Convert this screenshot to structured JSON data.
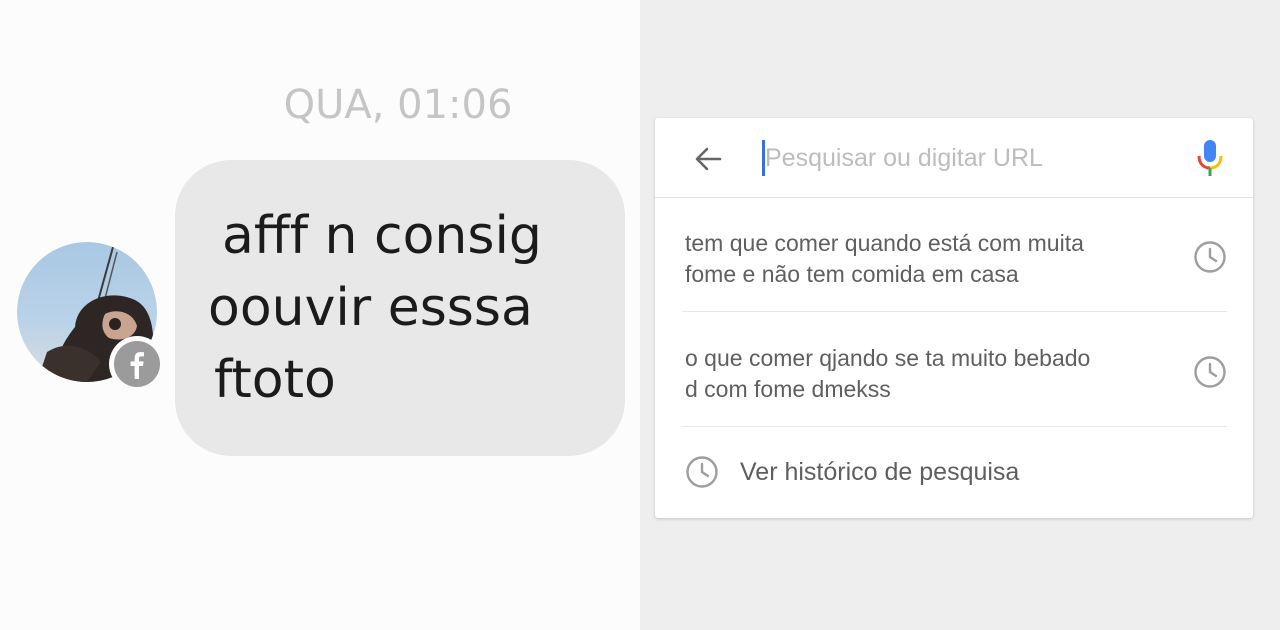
{
  "messenger": {
    "timestamp": "QUA, 01:06",
    "message_lines": [
      "afff n consig",
      "oouvir esssa",
      "ftoto"
    ],
    "badge_icon": "facebook-icon"
  },
  "browser": {
    "search": {
      "placeholder": "Pesquisar ou digitar URL",
      "value": ""
    },
    "suggestions": [
      {
        "line1": "tem que comer quando está com muita",
        "line2": "fome e não tem comida em casa",
        "icon": "clock-icon"
      },
      {
        "line1": "o que comer qjando se ta muito bebado",
        "line2": "d com fome dmekss",
        "icon": "clock-icon"
      }
    ],
    "history_label": "Ver histórico de pesquisa",
    "colors": {
      "cursor": "#3b6fe0",
      "mic_blue": "#4285f4",
      "mic_red": "#ea4335",
      "mic_yellow": "#fbbc05",
      "mic_green": "#34a853"
    }
  }
}
